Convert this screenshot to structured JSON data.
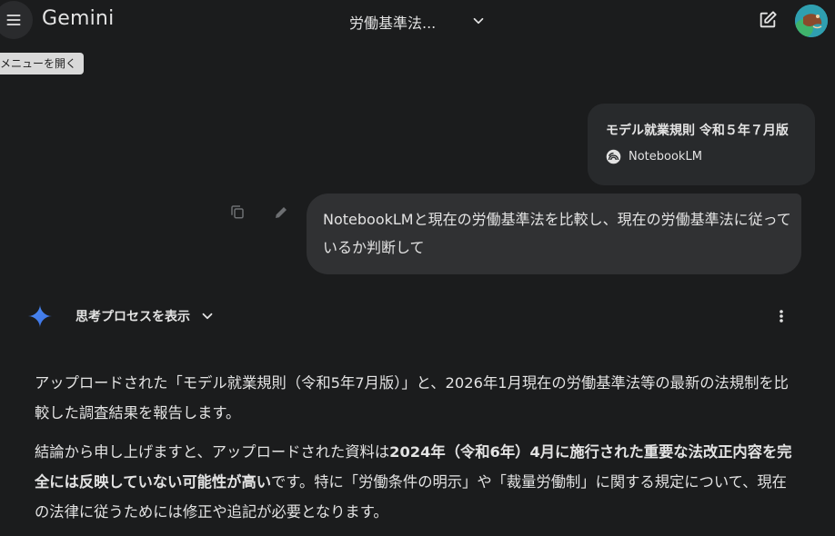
{
  "header": {
    "menu_tooltip": "メニューを開く",
    "app_title": "Gemini",
    "conversation_title": "労働基準法..."
  },
  "source": {
    "title": "モデル就業規則 令和５年７月版",
    "brand": "NotebookLM"
  },
  "user_message": "NotebookLMと現在の労働基準法を比較し、現在の労働基準法に従っているか判断して",
  "response": {
    "thinking_label": "思考プロセスを表示",
    "paragraph1": "アップロードされた「モデル就業規則（令和5年7月版）」と、2026年1月現在の労働基準法等の最新の法規制を比較した調査結果を報告します。",
    "paragraph2_intro": "結論から申し上げますと、アップロードされた資料は",
    "paragraph2_bold": "2024年（令和6年）4月に施行された重要な法改正内容を完全には反映していない可能性が高い",
    "paragraph2_rest": "です。特に「労働条件の明示」や「裁量労働制」に関する規定について、現在の法律に従うためには修正や追記が必要となります。"
  },
  "icons": {
    "menu": "hamburger-menu-icon",
    "chevron": "chevron-down-icon",
    "edit": "new-chat-edit-icon",
    "copy": "copy-icon",
    "pencil": "edit-pencil-icon",
    "spark": "gemini-spark-icon",
    "more": "more-vert-icon",
    "notebooklm": "notebooklm-logo-icon"
  },
  "colors": {
    "background": "#1b1c1d",
    "bubble": "#303133",
    "card": "#282a2c",
    "spark_blue": "#4c8df6"
  }
}
